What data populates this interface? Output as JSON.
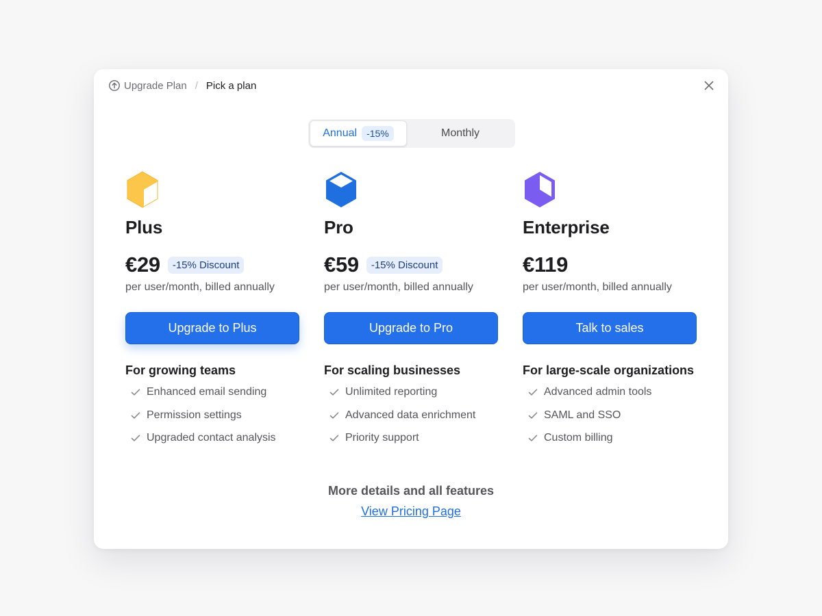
{
  "header": {
    "breadcrumb_root": "Upgrade Plan",
    "breadcrumb_separator": "/",
    "breadcrumb_current": "Pick a plan",
    "root_icon": "upgrade-arrow-icon",
    "close_icon": "close-icon"
  },
  "billing_toggle": {
    "annual_label": "Annual",
    "annual_badge": "-15%",
    "monthly_label": "Monthly",
    "selected": "annual"
  },
  "plans": [
    {
      "name": "Plus",
      "icon": "cube-yellow-icon",
      "color": "#fcc64a",
      "price": "€29",
      "discount": "-15% Discount",
      "billing": "per user/month, billed annually",
      "cta": "Upgrade to Plus",
      "section_title": "For growing teams",
      "features": [
        "Enhanced email sending",
        "Permission settings",
        "Upgraded contact analysis"
      ]
    },
    {
      "name": "Pro",
      "icon": "cube-blue-icon",
      "color": "#1f6fe0",
      "price": "€59",
      "discount": "-15% Discount",
      "billing": "per user/month, billed annually",
      "cta": "Upgrade to Pro",
      "section_title": "For scaling businesses",
      "features": [
        "Unlimited reporting",
        "Advanced data enrichment",
        "Priority support"
      ]
    },
    {
      "name": "Enterprise",
      "icon": "cube-purple-icon",
      "color": "#7b5cf0",
      "price": "€119",
      "discount": "",
      "billing": "per user/month, billed annually",
      "cta": "Talk to sales",
      "section_title": "For large-scale organizations",
      "features": [
        "Advanced admin tools",
        "SAML and SSO",
        "Custom billing"
      ]
    }
  ],
  "footer": {
    "text": "More details and all features",
    "link": "View Pricing Page"
  },
  "colors": {
    "accent": "#2370ea",
    "link": "#1f6fe0",
    "badge_bg": "#e6eefb"
  }
}
